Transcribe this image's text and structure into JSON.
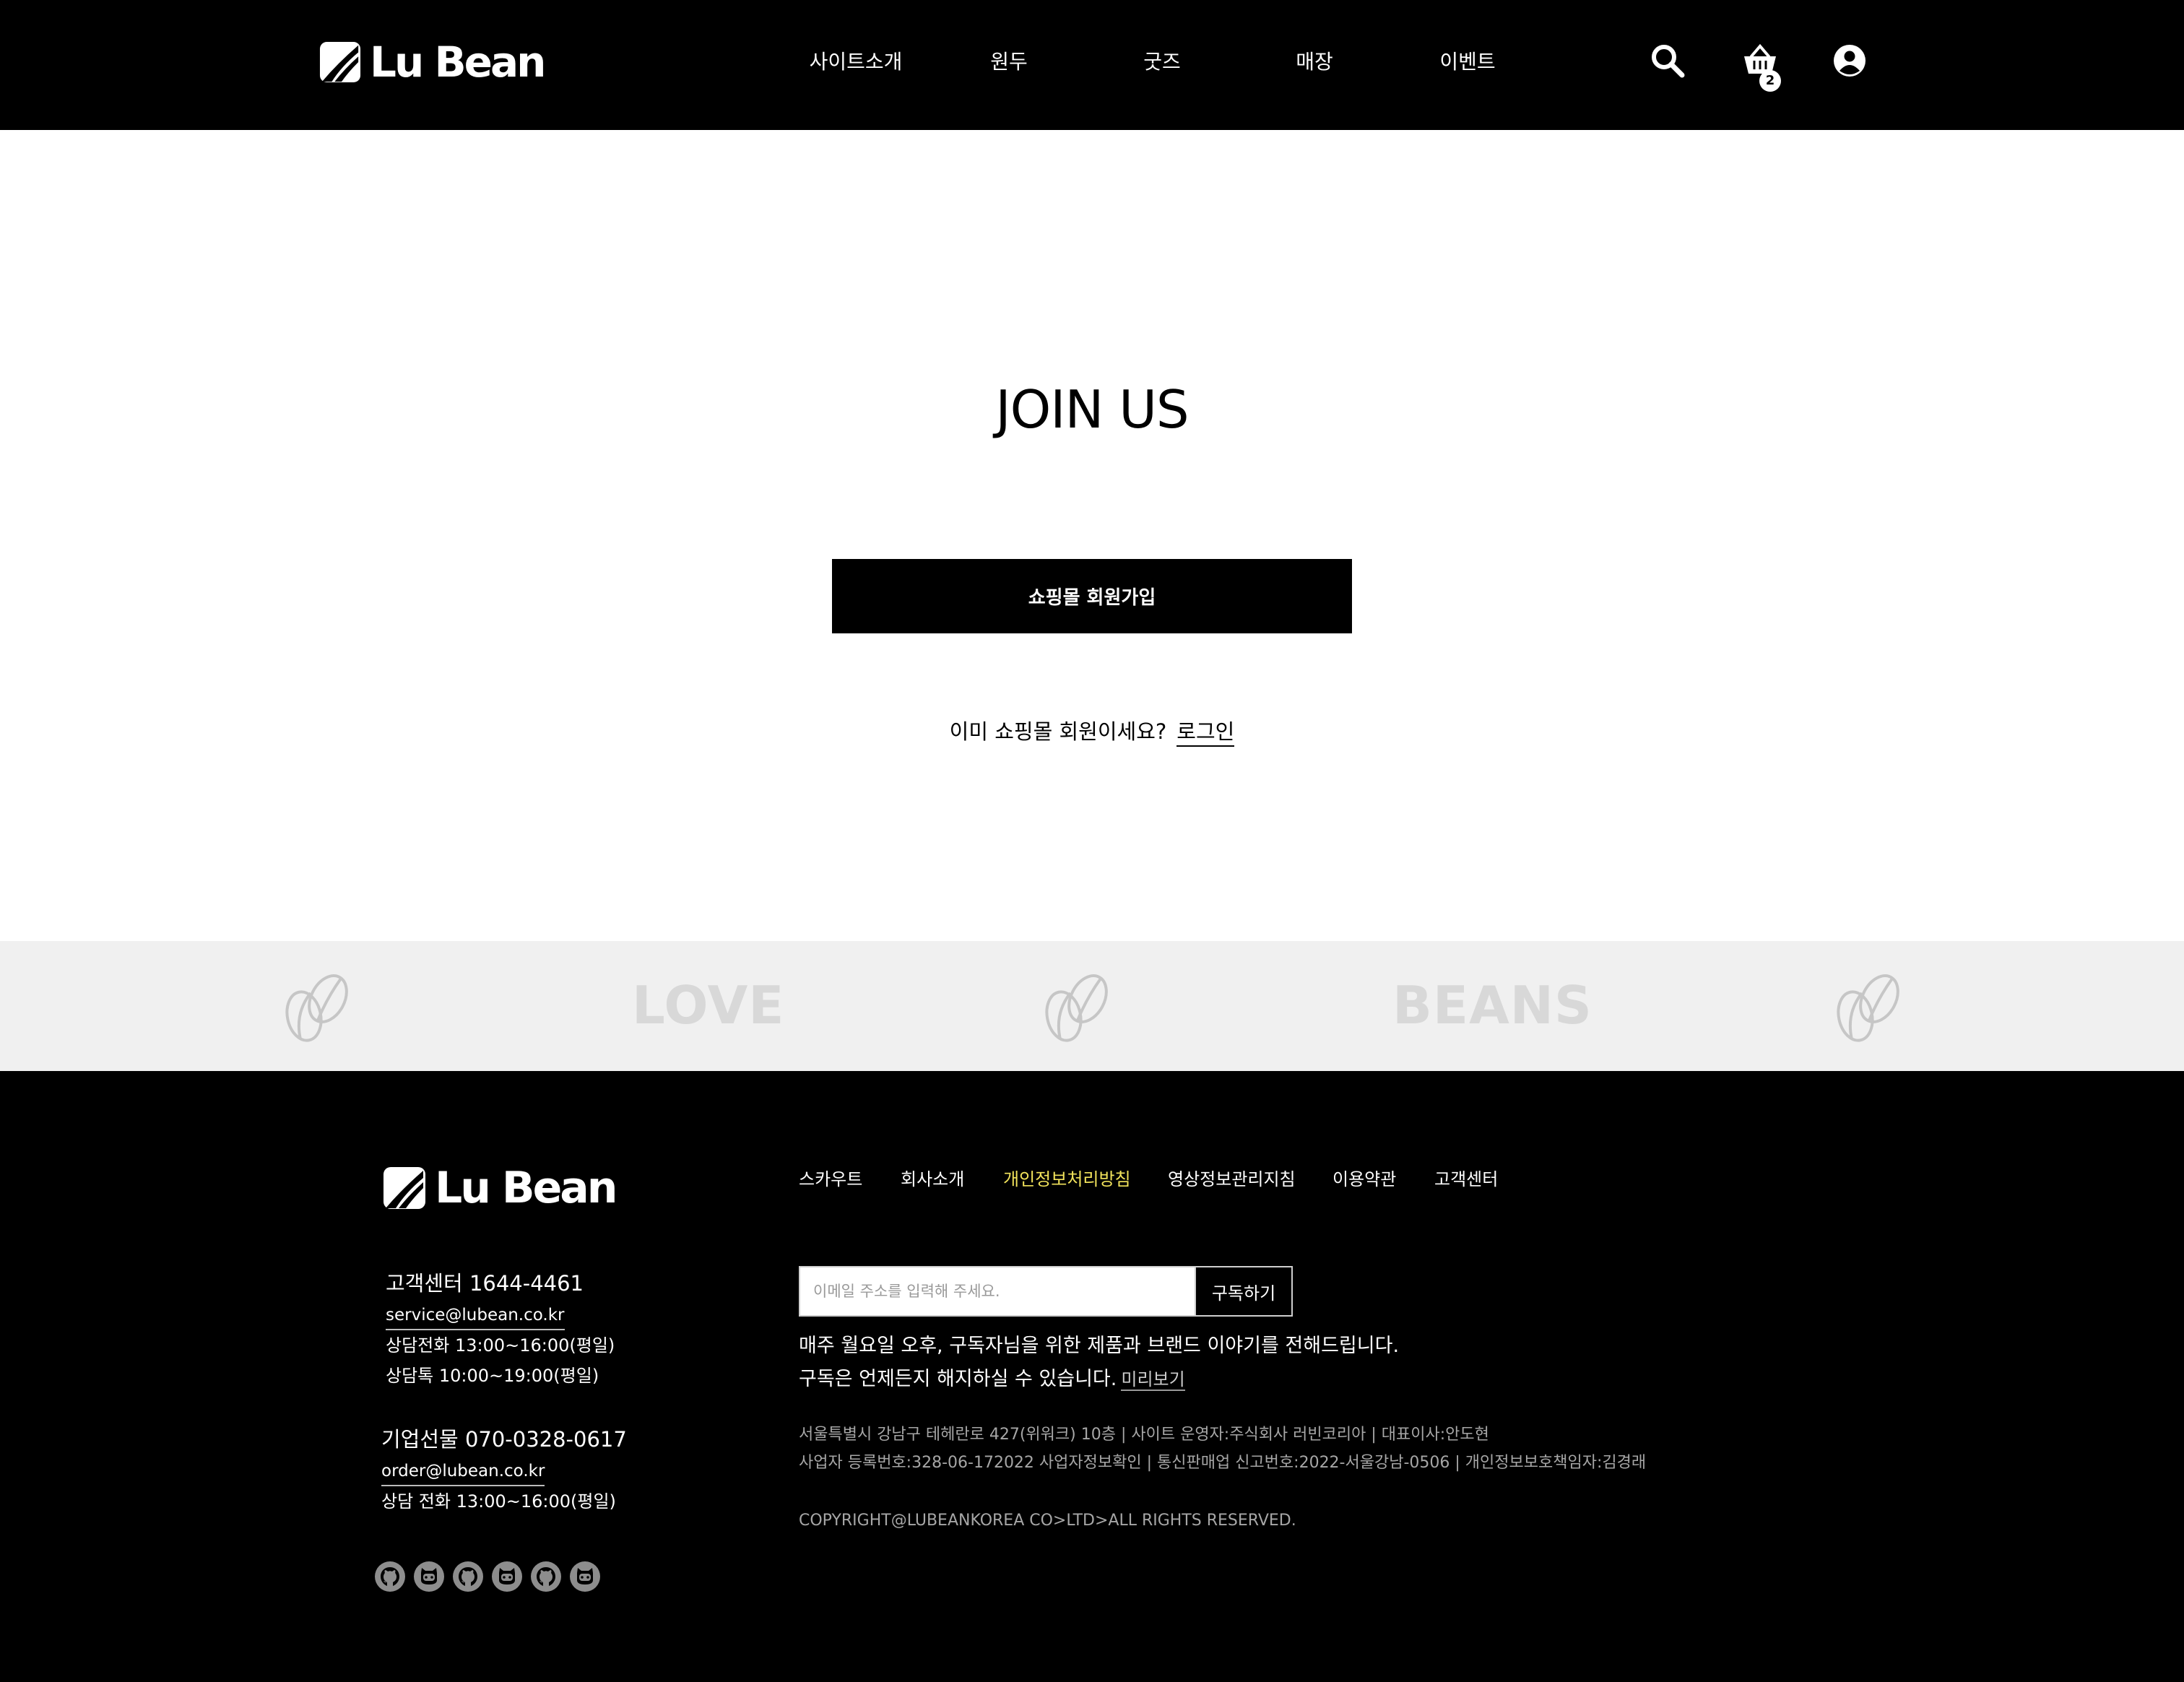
{
  "header": {
    "logo_text": "Lu Bean",
    "nav": [
      "사이트소개",
      "원두",
      "굿즈",
      "매장",
      "이벤트"
    ],
    "cart_count": "2"
  },
  "main": {
    "title": "JOIN US",
    "join_button": "쇼핑몰 회원가입",
    "login_prompt": "이미 쇼핑몰 회원이세요?",
    "login_link": "로그인"
  },
  "band": {
    "words": [
      "LOVE",
      "BEANS"
    ]
  },
  "footer": {
    "logo_text": "Lu Bean",
    "nav": [
      "스카우트",
      "회사소개",
      "개인정보처리방침",
      "영상정보관리지침",
      "이용약관",
      "고객센터"
    ],
    "customer_center": {
      "title": "고객센터 1644-4461",
      "email": "service@lubean.co.kr",
      "phone_hours": "상담전화 13:00~16:00(평일)",
      "chat_hours": "상담톡 10:00~19:00(평일)"
    },
    "corporate": {
      "title": "기업선물 070-0328-0617",
      "email": "order@lubean.co.kr",
      "phone_hours": "상담 전화 13:00~16:00(평일)"
    },
    "subscribe": {
      "placeholder": "이메일 주소를 입력해 주세요.",
      "button": "구독하기",
      "desc_line1": "매주 월요일 오후, 구독자님을 위한 제품과 브랜드 이야기를 전해드립니다.",
      "desc_line2": "구독은 언제든지 해지하실 수 있습니다.",
      "preview_link": "미리보기"
    },
    "info_line1": "서울특별시 강남구 테헤란로 427(위워크) 10층 | 사이트 운영자:주식회사 러빈코리아 | 대표이사:안도현",
    "info_line2": "사업자 등록번호:328-06-172022 사업자정보확인 | 통신판매업 신고번호:2022-서울강남-0506 | 개인정보보호책임자:김경래",
    "copyright": "COPYRIGHT@LUBEANKOREA CO>LTD>ALL RIGHTS RESERVED.",
    "social_icons": [
      "github-icon",
      "cat-icon",
      "github-icon",
      "cat-icon",
      "github-icon",
      "cat-icon"
    ]
  },
  "colors": {
    "header_bg": "#000000",
    "band_bg": "#f0f0f0",
    "footer_bg": "#000000",
    "footer_highlight": "#f1e25b"
  }
}
